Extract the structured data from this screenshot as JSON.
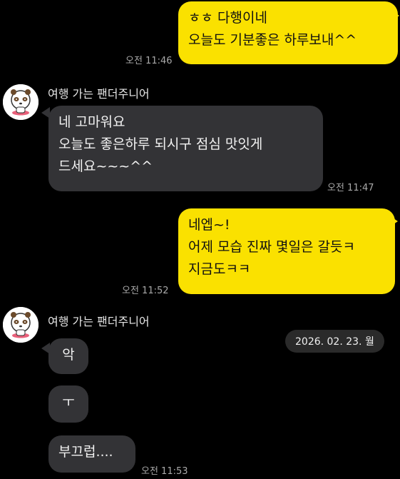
{
  "messages": [
    {
      "id": "m1",
      "side": "mine",
      "text": "ㅎㅎ 다행이네\n오늘도 기분좋은 하루보내^^",
      "time": "오전 11:46"
    },
    {
      "id": "m2",
      "side": "theirs",
      "sender": "여행 가는 팬더주니어",
      "text": "네 고마워요\n오늘도 좋은하루 되시구 점심 맛잇게\n드세요~~~^^",
      "time": "오전 11:47"
    },
    {
      "id": "m3",
      "side": "mine",
      "text": "네엡~!\n어제 모습 진짜 몇일은 갈듯ㅋ\n지금도ㅋㅋ",
      "time": "오전 11:52"
    },
    {
      "id": "m4",
      "side": "theirs",
      "sender": "여행 가는 팬더주니어",
      "text": "악"
    },
    {
      "id": "m5",
      "side": "theirs",
      "text": "ㅜ"
    },
    {
      "id": "m6",
      "side": "theirs",
      "text": "부끄럽....",
      "time": "오전 11:53"
    }
  ],
  "date_divider": "2026. 02. 23. 월",
  "icons": {
    "avatar": "panda-avatar-icon"
  },
  "colors": {
    "mine_bubble": "#fae100",
    "theirs_bubble": "#333336",
    "background": "#000000"
  }
}
